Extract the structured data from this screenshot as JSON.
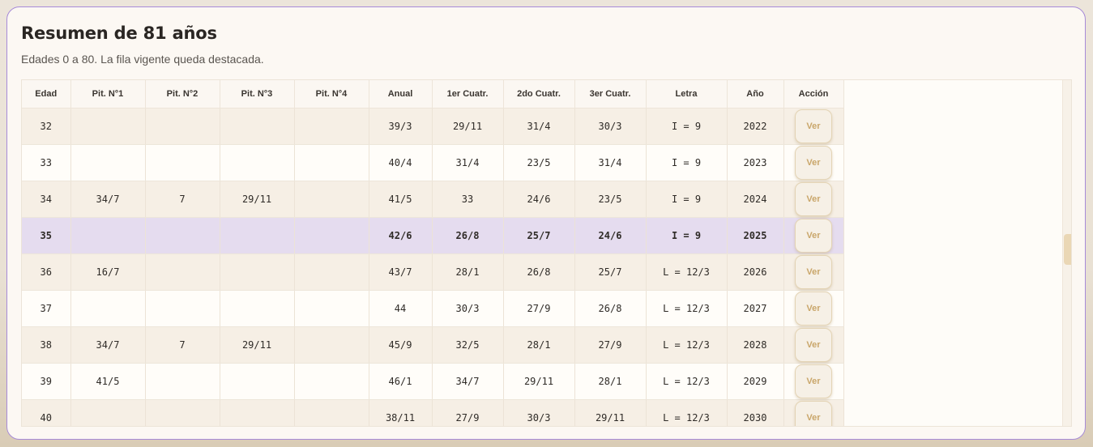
{
  "panel": {
    "title": "Resumen de 81 años",
    "subtitle": "Edades 0 a 80. La fila vigente queda destacada."
  },
  "table": {
    "headers": [
      "Edad",
      "Pit. N°1",
      "Pit. N°2",
      "Pit. N°3",
      "Pit. N°4",
      "Anual",
      "1er Cuatr.",
      "2do Cuatr.",
      "3er Cuatr.",
      "Letra",
      "Año",
      "Acción"
    ],
    "action_label": "Ver",
    "current_age": "35",
    "rows": [
      {
        "edad": "32",
        "p1": "",
        "p2": "",
        "p3": "",
        "p4": "",
        "anual": "39/3",
        "c1": "29/11",
        "c2": "31/4",
        "c3": "30/3",
        "letra": "I = 9",
        "anio": "2022"
      },
      {
        "edad": "33",
        "p1": "",
        "p2": "",
        "p3": "",
        "p4": "",
        "anual": "40/4",
        "c1": "31/4",
        "c2": "23/5",
        "c3": "31/4",
        "letra": "I = 9",
        "anio": "2023"
      },
      {
        "edad": "34",
        "p1": "34/7",
        "p2": "7",
        "p3": "29/11",
        "p4": "",
        "anual": "41/5",
        "c1": "33",
        "c2": "24/6",
        "c3": "23/5",
        "letra": "I = 9",
        "anio": "2024"
      },
      {
        "edad": "35",
        "p1": "",
        "p2": "",
        "p3": "",
        "p4": "",
        "anual": "42/6",
        "c1": "26/8",
        "c2": "25/7",
        "c3": "24/6",
        "letra": "I = 9",
        "anio": "2025"
      },
      {
        "edad": "36",
        "p1": "16/7",
        "p2": "",
        "p3": "",
        "p4": "",
        "anual": "43/7",
        "c1": "28/1",
        "c2": "26/8",
        "c3": "25/7",
        "letra": "L = 12/3",
        "anio": "2026"
      },
      {
        "edad": "37",
        "p1": "",
        "p2": "",
        "p3": "",
        "p4": "",
        "anual": "44",
        "c1": "30/3",
        "c2": "27/9",
        "c3": "26/8",
        "letra": "L = 12/3",
        "anio": "2027"
      },
      {
        "edad": "38",
        "p1": "34/7",
        "p2": "7",
        "p3": "29/11",
        "p4": "",
        "anual": "45/9",
        "c1": "32/5",
        "c2": "28/1",
        "c3": "27/9",
        "letra": "L = 12/3",
        "anio": "2028"
      },
      {
        "edad": "39",
        "p1": "41/5",
        "p2": "",
        "p3": "",
        "p4": "",
        "anual": "46/1",
        "c1": "34/7",
        "c2": "29/11",
        "c3": "28/1",
        "letra": "L = 12/3",
        "anio": "2029"
      },
      {
        "edad": "40",
        "p1": "",
        "p2": "",
        "p3": "",
        "p4": "",
        "anual": "38/11",
        "c1": "27/9",
        "c2": "30/3",
        "c3": "29/11",
        "letra": "L = 12/3",
        "anio": "2030"
      }
    ]
  },
  "colors": {
    "accent_border": "#a78bd8",
    "highlight_row": "#e5dcef",
    "button_text": "#c9a66a"
  }
}
